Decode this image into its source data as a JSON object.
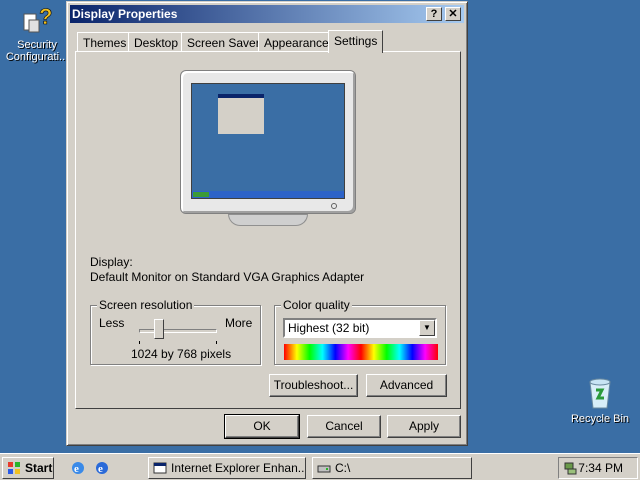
{
  "desktop": {
    "icons": [
      {
        "label": "Security Configurati..."
      },
      {
        "label": "Recycle Bin"
      }
    ]
  },
  "window": {
    "title": "Display Properties",
    "help_glyph": "?",
    "close_glyph": "✕",
    "tabs": [
      "Themes",
      "Desktop",
      "Screen Saver",
      "Appearance",
      "Settings"
    ],
    "active_tab": "Settings",
    "display_label": "Display:",
    "display_value": "Default Monitor on Standard VGA Graphics Adapter",
    "screen_resolution": {
      "title": "Screen resolution",
      "less": "Less",
      "more": "More",
      "value_text": "1024 by 768 pixels",
      "slider_level": 0.25
    },
    "color_quality": {
      "title": "Color quality",
      "selected": "Highest (32 bit)"
    },
    "buttons": {
      "troubleshoot": "Troubleshoot...",
      "advanced": "Advanced",
      "ok": "OK",
      "cancel": "Cancel",
      "apply": "Apply"
    }
  },
  "taskbar": {
    "start": "Start",
    "tasks": [
      "Internet Explorer Enhan...",
      "C:\\"
    ],
    "clock": "7:34 PM"
  }
}
